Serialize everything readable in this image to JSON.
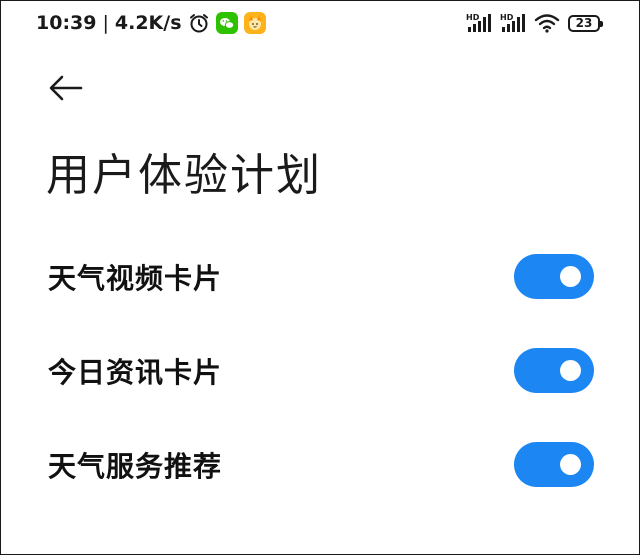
{
  "status_bar": {
    "time": "10:39",
    "separator": "|",
    "network_speed": "4.2K/s",
    "left_icons": [
      "alarm-icon",
      "wechat-icon",
      "app-notification-icon"
    ],
    "right_icons": [
      "hd-signal-icon",
      "hd-signal-icon",
      "wifi-icon",
      "battery-icon"
    ],
    "battery_level": "23",
    "hd_label": "HD",
    "wechat_color": "#2dc100",
    "app_icon_color": "#ffb31a"
  },
  "header": {
    "back_icon": "arrow-left-icon",
    "title": "用户体验计划"
  },
  "settings": [
    {
      "label": "天气视频卡片",
      "enabled": true
    },
    {
      "label": "今日资讯卡片",
      "enabled": true
    },
    {
      "label": "天气服务推荐",
      "enabled": true
    }
  ],
  "colors": {
    "toggle_on": "#1c86f2",
    "toggle_knob": "#ffffff",
    "text_primary": "#111111",
    "background": "#ffffff"
  }
}
